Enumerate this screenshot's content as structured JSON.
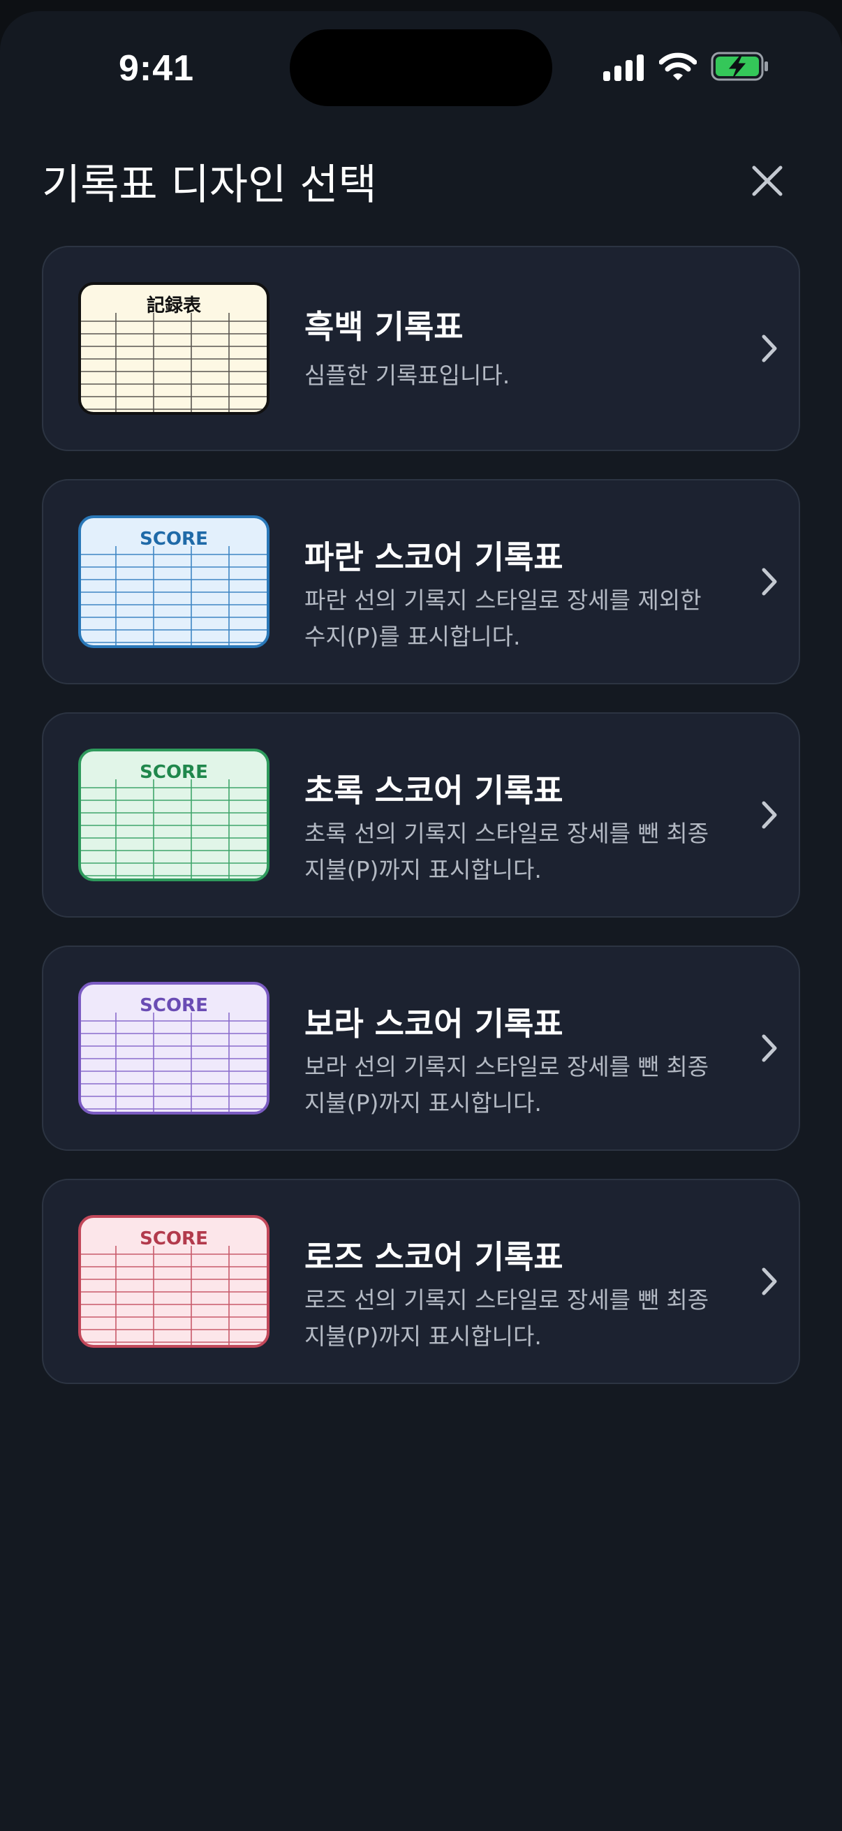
{
  "status_bar": {
    "time": "9:41",
    "icons": [
      "cellular-signal-icon",
      "wifi-icon",
      "battery-charging-icon"
    ],
    "battery_color": "#34c759"
  },
  "header": {
    "title": "기록표 디자인 선택",
    "close_icon": "close-icon"
  },
  "designs": [
    {
      "title": "흑백 기록표",
      "description": "심플한 기록표입니다.",
      "thumb_label": "記録表",
      "colors": {
        "border": "#111111",
        "fill": "#fdf8e4",
        "line": "#5a5650",
        "label": "#111111"
      }
    },
    {
      "title": "파란 스코어 기록표",
      "description": "파란 선의 기록지 스타일로 장세를 제외한 수지(P)를 표시합니다.",
      "thumb_label": "SCORE",
      "colors": {
        "border": "#2a78b8",
        "fill": "#e3f0fc",
        "line": "#3e86c4",
        "label": "#1f6aa8"
      }
    },
    {
      "title": "초록 스코어 기록표",
      "description": "초록 선의 기록지 스타일로 장세를 뺀 최종 지불(P)까지 표시합니다.",
      "thumb_label": "SCORE",
      "colors": {
        "border": "#2e9a5c",
        "fill": "#e1f5e8",
        "line": "#3fa56a",
        "label": "#20874c"
      }
    },
    {
      "title": "보라 스코어 기록표",
      "description": "보라 선의 기록지 스타일로 장세를 뺀 최종 지불(P)까지 표시합니다.",
      "thumb_label": "SCORE",
      "colors": {
        "border": "#7b5cc2",
        "fill": "#efe9fb",
        "line": "#8a6ccc",
        "label": "#6a4cb4"
      }
    },
    {
      "title": "로즈 스코어 기록표",
      "description": "로즈 선의 기록지 스타일로 장세를 뺀 최종 지불(P)까지 표시합니다.",
      "thumb_label": "SCORE",
      "colors": {
        "border": "#c2485a",
        "fill": "#fce6ea",
        "line": "#c85a6b",
        "label": "#b23a4c"
      }
    }
  ],
  "chevron_icon": "chevron-right-icon"
}
